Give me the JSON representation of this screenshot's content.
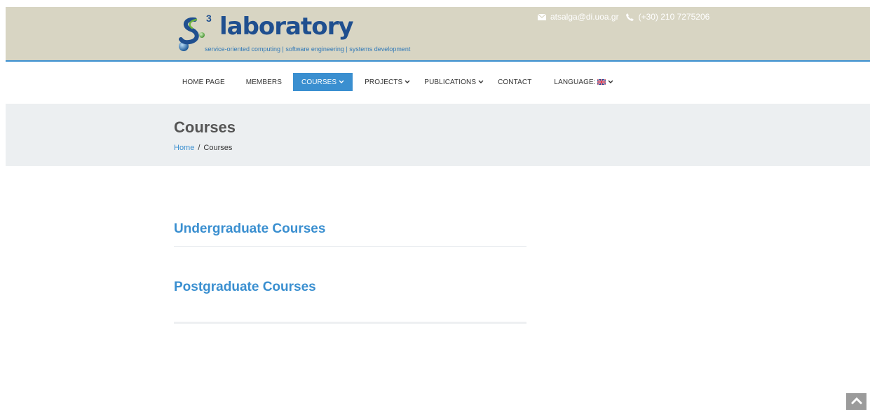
{
  "header": {
    "logo_sup": "3",
    "logo_word": "laboratory",
    "logo_tagline": "service-oriented computing | software engineering | systems development",
    "email": "atsalga@di.uoa.gr",
    "phone": "(+30) 210 7275206",
    "bg_color": "#d8d5c3",
    "accent_color": "#3a8fd0"
  },
  "nav": {
    "items": [
      {
        "label": "HOME PAGE"
      },
      {
        "label": "MEMBERS"
      },
      {
        "label": "COURSES",
        "active": true
      },
      {
        "label": "PROJECTS"
      },
      {
        "label": "PUBLICATIONS"
      },
      {
        "label": "CONTACT"
      },
      {
        "label": "LANGUAGE:"
      }
    ]
  },
  "page": {
    "title": "Courses",
    "breadcrumb": {
      "home": "Home",
      "separator": "/",
      "current": "Courses"
    }
  },
  "sections": [
    {
      "heading": "Undergraduate Courses"
    },
    {
      "heading": "Postgraduate Courses"
    }
  ],
  "icons": {
    "email": "envelope-icon",
    "phone": "phone-icon",
    "flag": "uk-flag-icon",
    "scroll_top": "chevron-up-icon"
  }
}
